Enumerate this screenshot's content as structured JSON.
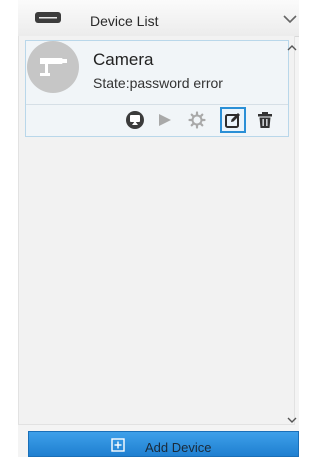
{
  "header": {
    "title": "Device List",
    "icon": "device-list-icon",
    "collapse_icon": "chevron-down-icon"
  },
  "devices": [
    {
      "name": "Camera",
      "state": "State:password error",
      "icon": "camera-icon",
      "actions": [
        "record-icon",
        "play-icon",
        "settings-icon",
        "edit-icon",
        "delete-icon"
      ],
      "selected_action": "edit-icon"
    }
  ],
  "add_button": {
    "label": "Add Device",
    "icon": "add-box-icon"
  },
  "colors": {
    "accent": "#2a8fd6",
    "button": "#2b8ddc",
    "card_border": "#b9d7ea"
  }
}
